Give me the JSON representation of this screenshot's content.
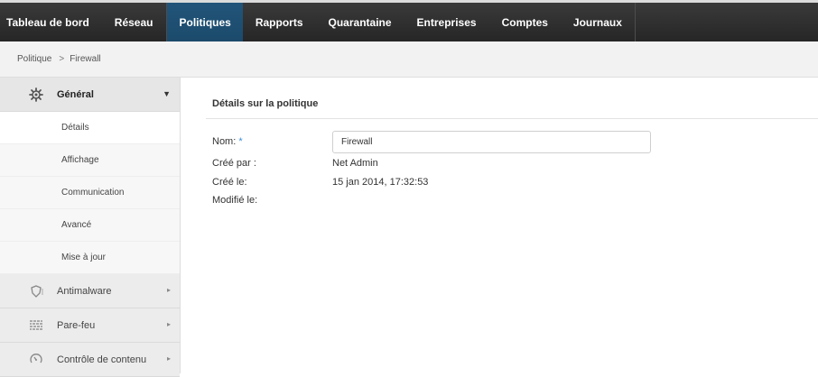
{
  "topnav": {
    "items": [
      "Tableau de bord",
      "Réseau",
      "Politiques",
      "Rapports",
      "Quarantaine",
      "Entreprises",
      "Comptes",
      "Journaux"
    ],
    "active": "Politiques"
  },
  "breadcrumb": {
    "root": "Politique",
    "separator": ">",
    "current": "Firewall"
  },
  "sidebar": {
    "general": {
      "label": "Général",
      "icon": "gear-icon",
      "items": [
        "Détails",
        "Affichage",
        "Communication",
        "Avancé",
        "Mise à jour"
      ],
      "active": "Détails"
    },
    "groups": [
      {
        "label": "Antimalware",
        "icon": "shield-icon"
      },
      {
        "label": "Pare-feu",
        "icon": "firewall-icon"
      },
      {
        "label": "Contrôle de contenu",
        "icon": "content-control-icon"
      }
    ]
  },
  "details": {
    "title": "Détails sur la politique",
    "name_label": "Nom:",
    "required_mark": "*",
    "name_value": "Firewall",
    "created_by_label": "Créé par :",
    "created_by_value": "Net Admin",
    "created_on_label": "Créé le:",
    "created_on_value": "15 jan 2014, 17:32:53",
    "modified_on_label": "Modifié le:"
  },
  "colors": {
    "nav_bg": "#2c2c2c",
    "nav_active": "#1f5075",
    "required": "#3a8ed6"
  }
}
